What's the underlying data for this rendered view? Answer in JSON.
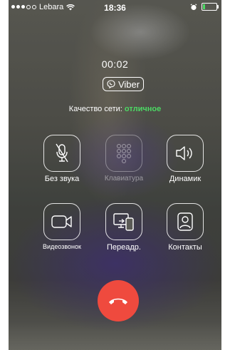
{
  "status_bar": {
    "carrier": "Lebara",
    "time": "18:36",
    "signal_bars_filled": 3,
    "signal_bars_total": 5,
    "battery_level": 0.2
  },
  "call": {
    "timer": "00:02",
    "app_label": "Viber",
    "network_label": "Качество сети:",
    "network_quality": "отличное"
  },
  "controls": {
    "mute": "Без звука",
    "keypad": "Клавиатура",
    "speaker": "Динамик",
    "video": "Видеозвонок",
    "transfer": "Переадр.",
    "contacts": "Контакты"
  },
  "colors": {
    "end_call": "#ef4a3e",
    "quality": "#4cd964"
  }
}
